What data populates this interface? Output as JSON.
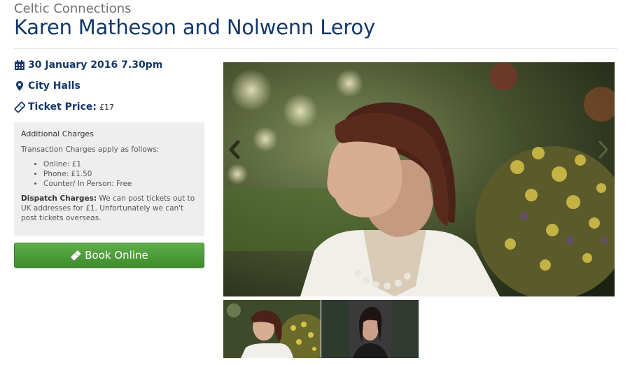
{
  "header": {
    "series": "Celtic Connections",
    "title": "Karen Matheson and Nolwenn Leroy"
  },
  "event": {
    "date": "30 January 2016 7.30pm",
    "venue": "City Halls",
    "price_label": "Ticket Price:",
    "price_value": "£17"
  },
  "charges": {
    "heading": "Additional Charges",
    "intro": "Transaction Charges apply as follows:",
    "items": [
      "Online: £1",
      "Phone: £1.50",
      "Counter/ In Person: Free"
    ],
    "dispatch_label": "Dispatch Charges:",
    "dispatch_text": "We can post tickets out to UK addresses for £1. Unfortunately we can't post tickets overseas."
  },
  "actions": {
    "book_label": "Book Online"
  },
  "icons": {
    "date": "calendar-icon",
    "venue": "map-marker-icon",
    "price": "ticket-icon",
    "book": "ticket-icon",
    "prev": "chevron-left-icon",
    "next": "chevron-right-icon"
  },
  "colors": {
    "title": "#14386a",
    "button": "#4a9b38",
    "panel": "#eeeeee"
  }
}
